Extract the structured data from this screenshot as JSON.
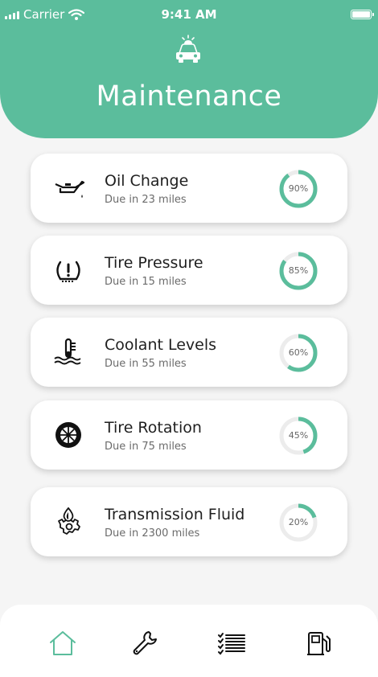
{
  "status_bar": {
    "carrier": "Carrier",
    "time": "9:41 AM"
  },
  "header": {
    "title": "Maintenance",
    "icon": "car-alert-icon"
  },
  "accent_color": "#5bbd9c",
  "items": [
    {
      "name": "Oil Change",
      "due": "Due in 23 miles",
      "percent_label": "90%",
      "progress": 0.9,
      "icon": "oil-can-icon"
    },
    {
      "name": "Tire Pressure",
      "due": "Due in 15 miles",
      "percent_label": "85%",
      "progress": 0.85,
      "icon": "tire-pressure-icon"
    },
    {
      "name": "Coolant Levels",
      "due": "Due in 55 miles",
      "percent_label": "60%",
      "progress": 0.6,
      "icon": "coolant-icon"
    },
    {
      "name": "Tire Rotation",
      "due": "Due in 75 miles",
      "percent_label": "45%",
      "progress": 0.45,
      "icon": "tire-icon"
    },
    {
      "name": "Transmission Fluid",
      "due": "Due in 2300 miles",
      "percent_label": "20%",
      "progress": 0.2,
      "icon": "transmission-fluid-icon"
    }
  ],
  "tab_bar": [
    {
      "icon": "home-icon",
      "active": true
    },
    {
      "icon": "wrench-icon",
      "active": false
    },
    {
      "icon": "checklist-icon",
      "active": false
    },
    {
      "icon": "fuel-pump-icon",
      "active": false
    }
  ]
}
